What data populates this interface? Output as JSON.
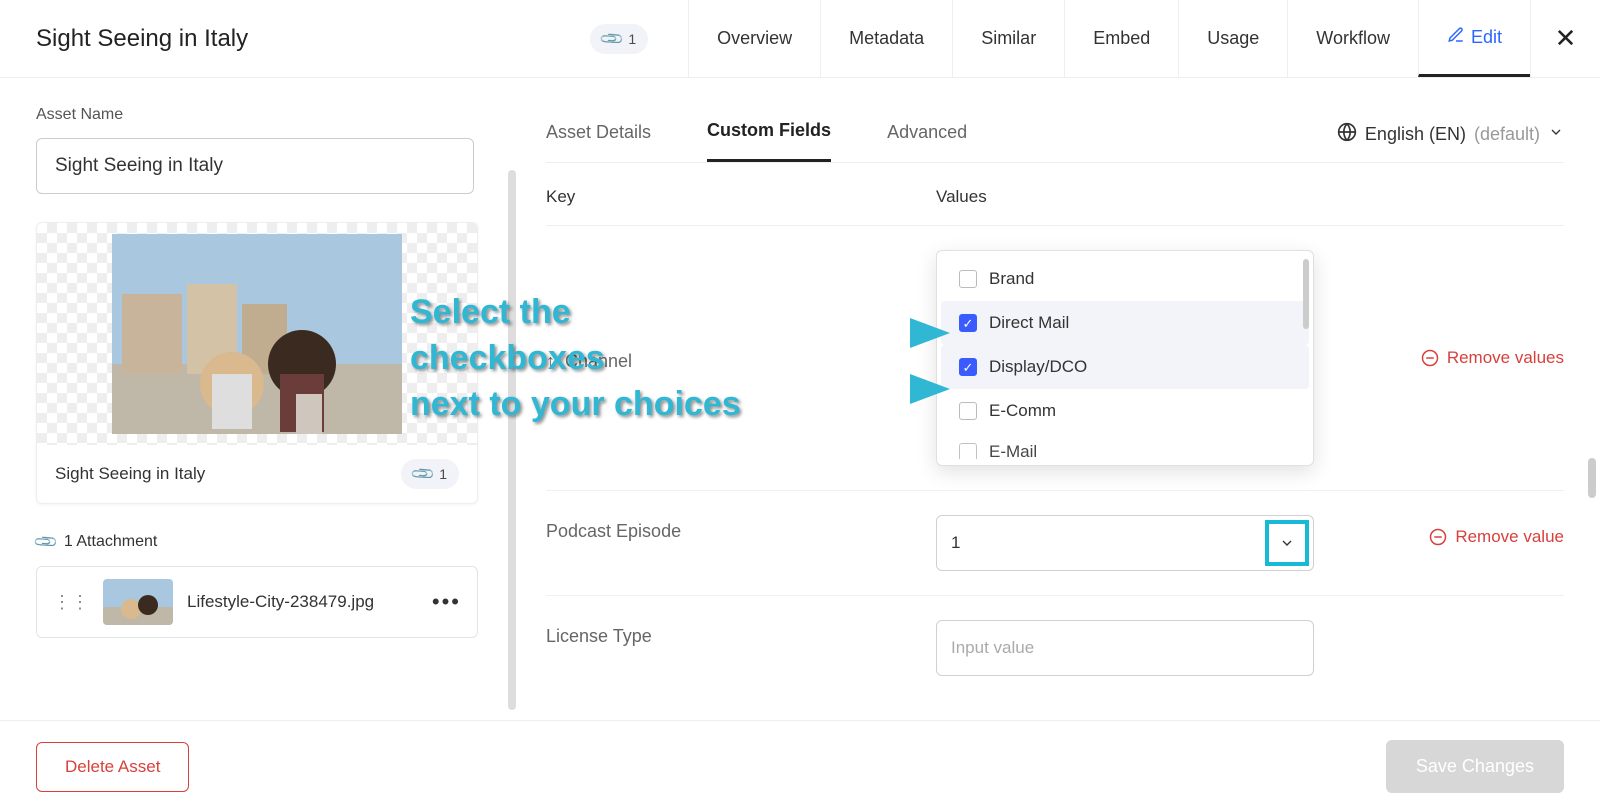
{
  "header": {
    "title": "Sight Seeing in Italy",
    "attachment_count": "1",
    "tabs": [
      "Overview",
      "Metadata",
      "Similar",
      "Embed",
      "Usage",
      "Workflow",
      "Edit"
    ],
    "active_tab": "Edit"
  },
  "left": {
    "asset_name_label": "Asset Name",
    "asset_name_value": "Sight Seeing in Italy",
    "thumbnail_title": "Sight Seeing in Italy",
    "thumbnail_badge": "1",
    "attachments_header": "1 Attachment",
    "attachment_file": "Lifestyle-City-238479.jpg"
  },
  "right": {
    "subtabs": [
      "Asset Details",
      "Custom Fields",
      "Advanced"
    ],
    "active_subtab": "Custom Fields",
    "language_label": "English (EN)",
    "language_default": "(default)",
    "columns": {
      "key": "Key",
      "values": "Values"
    },
    "rows": {
      "channel": {
        "label": "Channel",
        "options": [
          {
            "label": "Brand",
            "checked": false
          },
          {
            "label": "Direct Mail",
            "checked": true
          },
          {
            "label": "Display/DCO",
            "checked": true
          },
          {
            "label": "E-Comm",
            "checked": false
          },
          {
            "label": "E-Mail",
            "checked": false
          }
        ],
        "remove_label": "Remove values"
      },
      "podcast": {
        "label": "Podcast Episode",
        "value": "1",
        "remove_label": "Remove value"
      },
      "license": {
        "label": "License Type",
        "placeholder": "Input value"
      }
    }
  },
  "footer": {
    "delete_label": "Delete Asset",
    "save_label": "Save Changes"
  },
  "annotation": {
    "line1": "Select the",
    "line2": "checkboxes",
    "line3": "next to your choices"
  }
}
